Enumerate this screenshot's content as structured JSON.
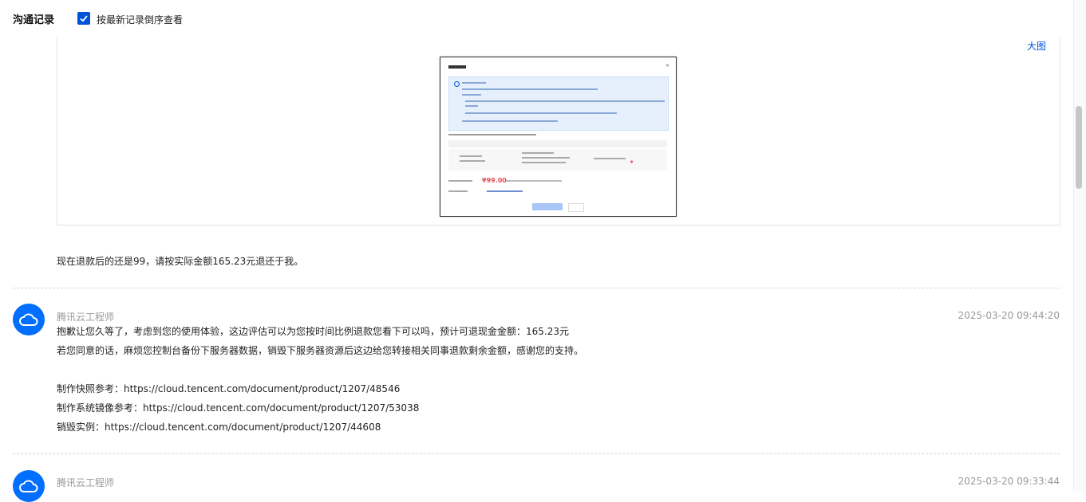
{
  "header": {
    "title": "沟通记录",
    "sort_label": "按最新记录倒序查看",
    "sort_checked": true
  },
  "attachment": {
    "big_image_link": "大图",
    "screenshot": {
      "price": "¥99.00"
    }
  },
  "messages": [
    {
      "lines": [
        "现在退款后的还是99，请按实际金额165.23元退还于我。"
      ]
    },
    {
      "sender": "腾讯云工程师",
      "time": "2025-03-20 09:44:20",
      "lines": [
        "抱歉让您久等了，考虑到您的使用体验，这边评估可以为您按时间比例退款您看下可以吗，预计可退现金金额：165.23元",
        "若您同意的话，麻烦您控制台备份下服务器数据，销毁下服务器资源后这边给您转接相关同事退款剩余金额，感谢您的支持。",
        "制作快照参考：https://cloud.tencent.com/document/product/1207/48546",
        "制作系统镜像参考：https://cloud.tencent.com/document/product/1207/53038",
        "销毁实例：https://cloud.tencent.com/document/product/1207/44608"
      ]
    },
    {
      "sender": "腾讯云工程师",
      "time": "2025-03-20 09:33:44"
    }
  ],
  "colors": {
    "accent": "#0052d9",
    "avatar": "#006eff",
    "muted": "#999999"
  },
  "icons": {
    "checkbox": "check-icon",
    "avatar": "cloud-icon"
  }
}
